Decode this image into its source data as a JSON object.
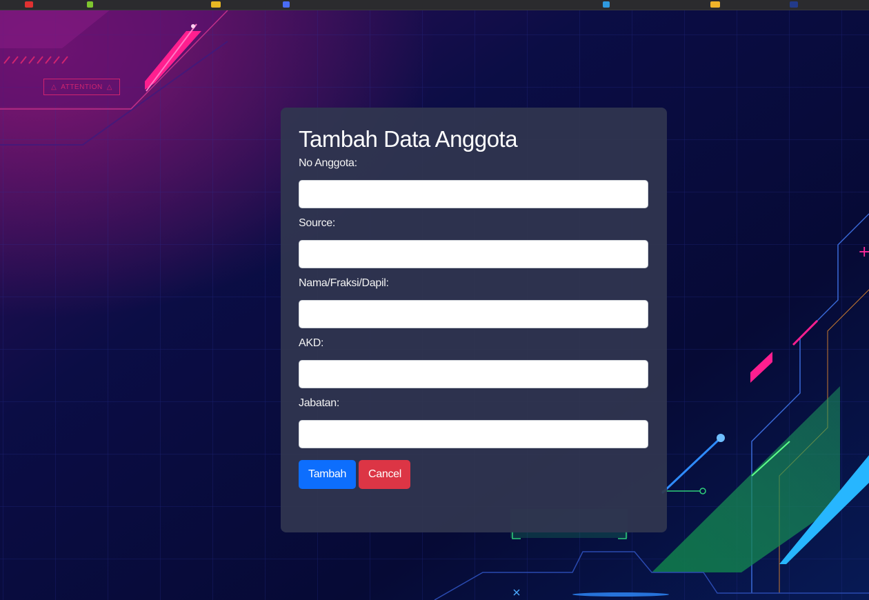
{
  "bookmark_colors": [
    "#e03131",
    "#7ec62f",
    "#e8b923",
    "#4a6cf7",
    "#2f9ae0",
    "#f0b429",
    "#223a8a"
  ],
  "background": {
    "badge_text": "ATTENTION",
    "badge_icon": "warning-triangle-icon"
  },
  "form": {
    "title": "Tambah Data Anggota",
    "fields": [
      {
        "label": "No Anggota:",
        "value": ""
      },
      {
        "label": "Source:",
        "value": ""
      },
      {
        "label": "Nama/Fraksi/Dapil:",
        "value": ""
      },
      {
        "label": "AKD:",
        "value": ""
      },
      {
        "label": "Jabatan:",
        "value": ""
      }
    ],
    "submit_label": "Tambah",
    "cancel_label": "Cancel"
  }
}
